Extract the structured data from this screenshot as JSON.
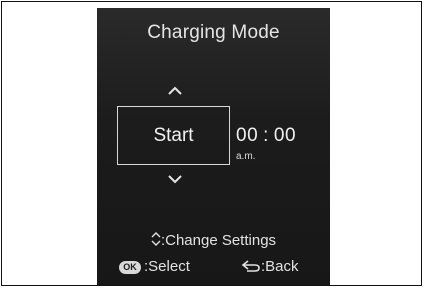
{
  "screen": {
    "title": "Charging Mode",
    "option_label": "Start",
    "time": {
      "hours": "00",
      "separator": ":",
      "minutes": "00",
      "period": "a.m."
    }
  },
  "help": {
    "change_settings": ":Change Settings",
    "ok_key": "OK",
    "select": ":Select",
    "back": ":Back"
  },
  "colors": {
    "screen_background": "#1c1c1c",
    "text": "#e8e8e8",
    "border": "#d8d8d8"
  }
}
